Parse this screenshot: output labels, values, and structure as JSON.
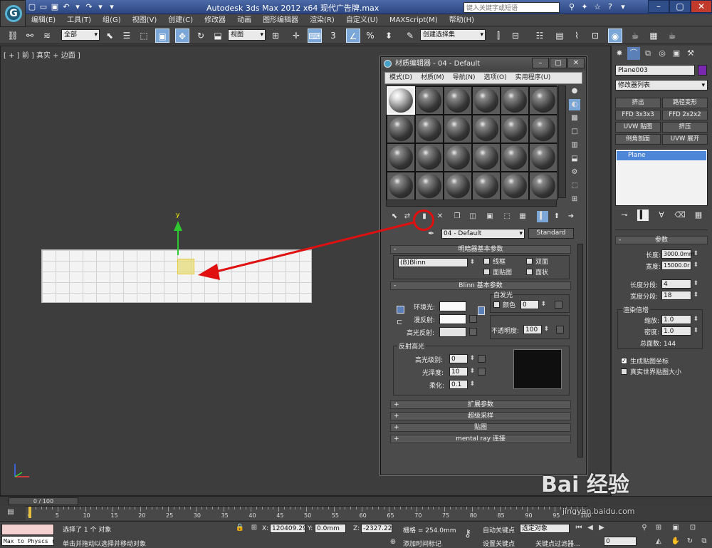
{
  "app": {
    "title": "Autodesk 3ds Max  2012 x64     现代广告牌.max",
    "search_placeholder": "键入关键字或短语",
    "logo_letter": "G"
  },
  "menu": [
    "编辑(E)",
    "工具(T)",
    "组(G)",
    "视图(V)",
    "创建(C)",
    "修改器",
    "动画",
    "图形编辑器",
    "渲染(R)",
    "自定义(U)",
    "MAXScript(M)",
    "帮助(H)"
  ],
  "toolbar": {
    "filter": "全部",
    "view": "视图",
    "angle_snap": "3",
    "selection_set": "创建选择集"
  },
  "viewport": {
    "label": "[ + ] 前 ] 真实 + 边面 ]",
    "axis_y": "y"
  },
  "material_editor": {
    "title": "材质编辑器 - 04 - Default",
    "menu": [
      "模式(D)",
      "材质(M)",
      "导航(N)",
      "选项(O)",
      "实用程序(U)"
    ],
    "material_name": "04 - Default",
    "material_type": "Standard",
    "shader_rollout": {
      "title": "明暗器基本参数",
      "shader": "(B)Blinn",
      "wire": "线框",
      "two_sided": "双面",
      "face_map": "面贴图",
      "faceted": "面状"
    },
    "blinn_rollout": {
      "title": "Blinn 基本参数",
      "self_illum": "自发光",
      "color": "颜色",
      "color_val": "0",
      "ambient": "环境光:",
      "diffuse": "漫反射:",
      "specular": "高光反射:",
      "opacity": "不透明度:",
      "opacity_val": "100"
    },
    "highlights": {
      "title": "反射高光",
      "spec_level": "高光级别:",
      "spec_level_val": "0",
      "gloss": "光泽度:",
      "gloss_val": "10",
      "soften": "柔化:",
      "soften_val": "0.1"
    },
    "rollouts": [
      "扩展参数",
      "超级采样",
      "贴图",
      "mental ray 连接"
    ]
  },
  "command_panel": {
    "object_name": "Plane003",
    "modifier_list": "修改器列表",
    "modifier_buttons": [
      "挤出",
      "路径变形",
      "FFD 3x3x3",
      "FFD 2x2x2",
      "UVW 贴图",
      "挤压",
      "倒角剖面",
      "UVW 展开"
    ],
    "stack_item": "Plane",
    "params_title": "参数",
    "length_label": "长度:",
    "length_val": "3000.0mm",
    "width_label": "宽度:",
    "width_val": "15000.0r",
    "length_segs_label": "长度分段:",
    "length_segs_val": "4",
    "width_segs_label": "宽度分段:",
    "width_segs_val": "18",
    "render_mult": "渲染倍增",
    "scale_label": "缩放:",
    "scale_val": "1.0",
    "density_label": "密度:",
    "density_val": "1.0",
    "total_faces": "总面数: 144",
    "gen_map_coords": "生成贴图坐标",
    "real_world": "真实世界贴图大小"
  },
  "timeline": {
    "frame_slider": "0 / 100",
    "ticks": [
      "0",
      "5",
      "10",
      "15",
      "20",
      "25",
      "30",
      "35",
      "40",
      "45",
      "50",
      "55",
      "60",
      "65",
      "70",
      "75",
      "80",
      "85",
      "90",
      "95",
      "100"
    ]
  },
  "status": {
    "maxscript": "Max to Physcs (",
    "selected": "选择了 1 个 对象",
    "hint": "单击并拖动以选择并移动对象",
    "x_label": "X:",
    "x_val": "120409.29",
    "y_label": "Y:",
    "y_val": "0.0mm",
    "z_label": "Z:",
    "z_val": "-2327.222",
    "grid": "栅格 = 254.0mm",
    "auto_key": "自动关键点",
    "selected_obj": "选定对象",
    "set_key": "设置关键点",
    "key_filter": "关键点过滤器...",
    "add_tag": "添加时间标记",
    "frame": "0"
  },
  "watermark": {
    "brand": "Bai 经验",
    "url": "jingyan.baidu.com"
  },
  "colors": {
    "annotation_red": "#e01010",
    "selection_blue": "#4d86d6",
    "object_color": "#7a28b0"
  }
}
